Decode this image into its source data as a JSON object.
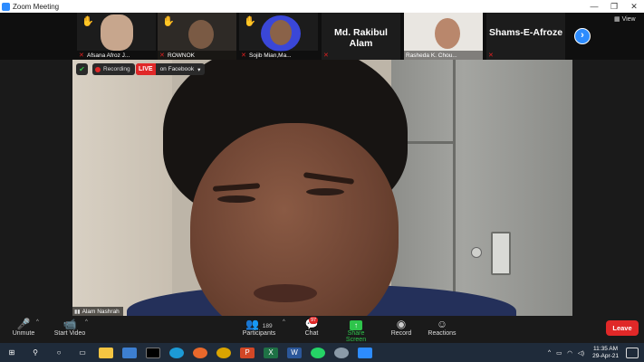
{
  "window": {
    "title": "Zoom Meeting",
    "minimize": "—",
    "maximize": "❐",
    "close": "✕"
  },
  "gallery": {
    "participants": [
      {
        "name": "Afsana Afroz J...",
        "raised_hand": true,
        "video": true
      },
      {
        "name": "ROWNOK",
        "raised_hand": true,
        "video": true
      },
      {
        "name": "Sojib Mian,Ma...",
        "raised_hand": true,
        "video": true
      },
      {
        "name": "Md. Rakibul Alam",
        "raised_hand": false,
        "video": false
      },
      {
        "name": "Rasheda K. Chou...",
        "raised_hand": false,
        "video": true
      },
      {
        "name": "Shams-E-Afroze",
        "raised_hand": false,
        "video": false
      }
    ],
    "next_arrow": "›",
    "view_label": "View"
  },
  "speaker": {
    "name": "Alam Nashrah",
    "recording_label": "Recording",
    "live_label": "LIVE",
    "live_target": "on Facebook",
    "live_caret": "▾"
  },
  "toolbar": {
    "unmute": "Unmute",
    "start_video": "Start Video",
    "participants": "Participants",
    "participant_count": "189",
    "chat": "Chat",
    "chat_badge": "97",
    "share_screen": "Share Screen",
    "record": "Record",
    "reactions": "Reactions",
    "leave": "Leave"
  },
  "taskbar": {
    "time": "11:35 AM",
    "date": "29-Apr-21",
    "tray_chevron": "^"
  },
  "colors": {
    "zoom_blue": "#2d8cff",
    "live_red": "#e02828",
    "share_green": "#2ec44b"
  }
}
